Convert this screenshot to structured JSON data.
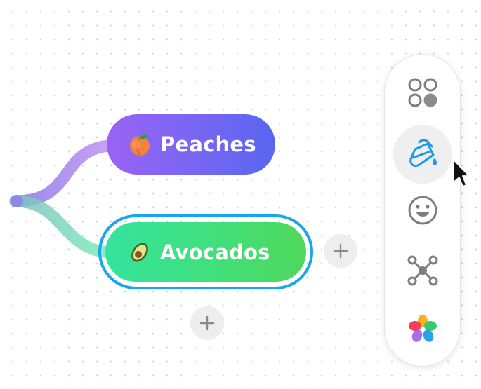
{
  "mindmap": {
    "nodes": [
      {
        "label": "Peaches",
        "emoji": "peach-emoji",
        "colors": [
          "#9a63f5",
          "#5866ef"
        ]
      },
      {
        "label": "Avocados",
        "emoji": "avocado-emoji",
        "colors": [
          "#35e39e",
          "#4fd85b"
        ],
        "selected": true
      }
    ],
    "add_buttons": [
      {
        "icon": "plus-icon",
        "position": "right-of-selected-node"
      },
      {
        "icon": "plus-icon",
        "position": "below-selected-node"
      }
    ],
    "selection_color": "#1aa3ee"
  },
  "toolbar": {
    "items": [
      {
        "icon": "layout-circles-icon",
        "active": false
      },
      {
        "icon": "paint-bucket-icon",
        "active": true,
        "color": "#1a9bea"
      },
      {
        "icon": "smiley-icon",
        "active": false
      },
      {
        "icon": "connector-nodes-icon",
        "active": false
      },
      {
        "icon": "color-palette-icon",
        "active": false
      }
    ]
  }
}
